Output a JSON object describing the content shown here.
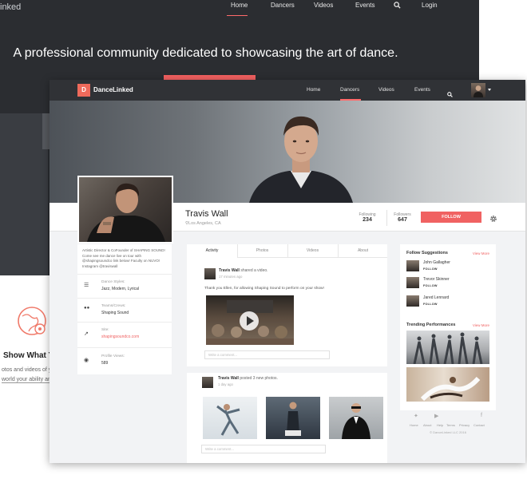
{
  "background_site": {
    "logo": "inked",
    "nav": [
      "Home",
      "Dancers",
      "Videos",
      "Events",
      "Login"
    ],
    "headline": "A professional community dedicated to showcasing the art of dance.",
    "feature_title": "Show What You",
    "feature_text_1": "otos and videos of y",
    "feature_text_2": "world your ability and"
  },
  "navbar": {
    "logo_mark": "D",
    "logo_text": "DanceLinked",
    "items": [
      "Home",
      "Dancers",
      "Videos",
      "Events"
    ],
    "active": "Dancers",
    "icons": [
      "search-icon",
      "avatar",
      "chevron-down-icon"
    ]
  },
  "profile": {
    "name": "Travis Wall",
    "location": "Los Angeles, CA",
    "following_label": "Following",
    "following_value": "234",
    "followers_label": "Followers",
    "followers_value": "647",
    "follow_button": "FOLLOW",
    "bio": "Artistic Director & CoFounder of SHAPING SOUND! Come see me dance live on tour with @shapingsoundco link below! Faculty on NUVO! Instagram @traviswall",
    "details": [
      {
        "label": "Dance Styles:",
        "value": "Jazz, Modern, Lyrical",
        "icon": "list-icon"
      },
      {
        "label": "Teams/Crews:",
        "value": "Shaping Sound",
        "icon": "group-icon"
      },
      {
        "label": "Site:",
        "value": "shapingsoundco.com",
        "icon": "external-link-icon"
      },
      {
        "label": "Profile Views:",
        "value": "589",
        "icon": "eye-icon"
      }
    ]
  },
  "feed": {
    "tabs": [
      "Activity",
      "Photos",
      "Videos",
      "About"
    ],
    "active_tab": "Activity",
    "posts": [
      {
        "author": "Travis Wall",
        "action": "shared a video.",
        "time": "17 minutes ago",
        "text": "Thank you Ellen, for allowing Shaping Sound to perform on your show!",
        "comment_placeholder": "Write a comment..."
      },
      {
        "author": "Travis Wall",
        "action": "posted 3 new photos.",
        "time": "1 day ago",
        "comment_placeholder": "Write a comment..."
      }
    ]
  },
  "sidebar": {
    "suggestions_title": "Follow Suggestions",
    "view_more": "View More",
    "suggestions": [
      {
        "name": "John Gallagher",
        "button": "FOLLOW"
      },
      {
        "name": "Trevor Skinner",
        "button": "FOLLOW"
      },
      {
        "name": "Jared Lennard",
        "button": "FOLLOW"
      }
    ],
    "trending_title": "Trending Performances",
    "trending_view_more": "View More"
  },
  "footer": {
    "icons": [
      "twitter-icon",
      "youtube-icon",
      "facebook-icon"
    ],
    "links": [
      "Home",
      "About",
      "Help",
      "Terms",
      "Privacy",
      "Contact"
    ],
    "copyright": "© DanceLinked LLC 2016"
  },
  "colors": {
    "accent": "#f06262",
    "navbar": "#303236",
    "page_bg": "#f2f3f5"
  }
}
